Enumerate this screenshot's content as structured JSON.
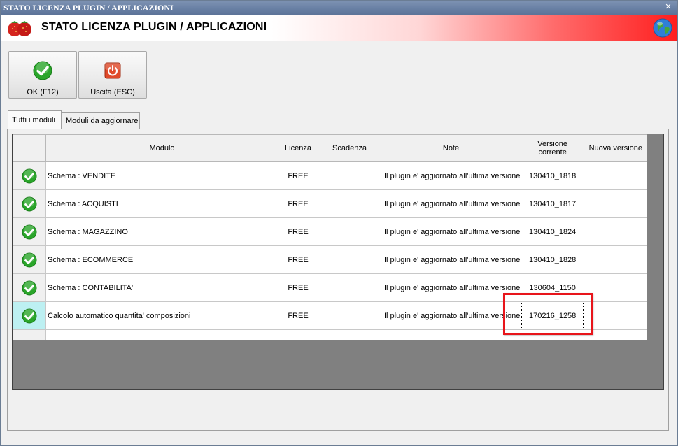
{
  "window": {
    "title": "STATO LICENZA PLUGIN / APPLICAZIONI",
    "close_glyph": "✕"
  },
  "header": {
    "title": "STATO LICENZA PLUGIN / APPLICAZIONI",
    "logo_icon": "strawberry-icon",
    "globe_icon": "globe-icon"
  },
  "toolbar": {
    "ok_label": "OK (F12)",
    "ok_icon": "green-check-icon",
    "exit_label": "Uscita (ESC)",
    "exit_icon": "power-icon"
  },
  "tabs": [
    {
      "label": "Tutti i moduli",
      "active": true
    },
    {
      "label": "Moduli da aggiornare",
      "active": false
    }
  ],
  "grid": {
    "columns": [
      "",
      "Modulo",
      "Licenza",
      "Scadenza",
      "Note",
      "Versione corrente",
      "Nuova versione"
    ],
    "header": {
      "modulo": "Modulo",
      "licenza": "Licenza",
      "scadenza": "Scadenza",
      "note": "Note",
      "versione_line1": "Versione",
      "versione_line2": "corrente",
      "nuova": "Nuova versione"
    },
    "rows": [
      {
        "status": "ok",
        "modulo": "Schema : VENDITE",
        "licenza": "FREE",
        "scadenza": "",
        "note": "Il plugin e' aggiornato all'ultima versione",
        "versione": "130410_1818",
        "nuova": ""
      },
      {
        "status": "ok",
        "modulo": "Schema : ACQUISTI",
        "licenza": "FREE",
        "scadenza": "",
        "note": "Il plugin e' aggiornato all'ultima versione",
        "versione": "130410_1817",
        "nuova": ""
      },
      {
        "status": "ok",
        "modulo": "Schema : MAGAZZINO",
        "licenza": "FREE",
        "scadenza": "",
        "note": "Il plugin e' aggiornato all'ultima versione",
        "versione": "130410_1824",
        "nuova": ""
      },
      {
        "status": "ok",
        "modulo": "Schema : ECOMMERCE",
        "licenza": "FREE",
        "scadenza": "",
        "note": "Il plugin e' aggiornato all'ultima versione",
        "versione": "130410_1828",
        "nuova": ""
      },
      {
        "status": "ok",
        "modulo": "Schema : CONTABILITA'",
        "licenza": "FREE",
        "scadenza": "",
        "note": "Il plugin e' aggiornato all'ultima versione",
        "versione": "130604_1150",
        "nuova": ""
      },
      {
        "status": "ok",
        "modulo": "Calcolo automatico quantita' composizioni",
        "licenza": "FREE",
        "scadenza": "",
        "note": "Il plugin e' aggiornato all'ultima versione",
        "versione": "170216_1258",
        "nuova": ""
      }
    ],
    "selected_row_index": 5
  },
  "colors": {
    "highlight": "#e8151b",
    "selected_indicator": "#bdf0f2",
    "grid_background": "#808080"
  }
}
